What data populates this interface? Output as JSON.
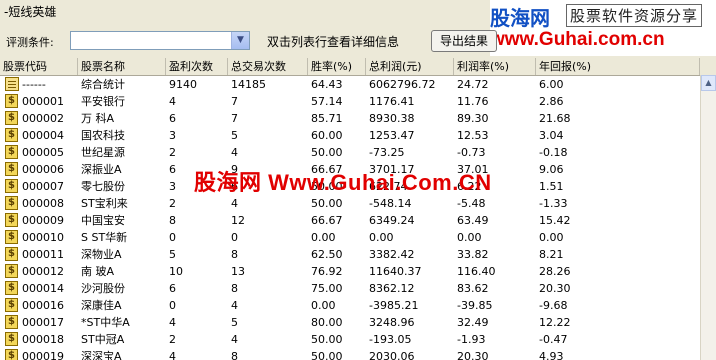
{
  "window": {
    "title": "-短线英雄"
  },
  "logo": {
    "name": "股海网",
    "tagline": "股票软件资源分享",
    "url": "www.Guhai.com.cn"
  },
  "toolbar": {
    "filter_label": "评测条件:",
    "filter_value": "",
    "hint": "双击列表行查看详细信息",
    "export_label": "导出结果"
  },
  "watermark": "股海网 Www.Guhai.Com.CN",
  "table": {
    "columns": [
      "股票代码",
      "股票名称",
      "盈利次数",
      "总交易次数",
      "胜率(%)",
      "总利润(元)",
      "利润率(%)",
      "年回报(%)"
    ],
    "rows": [
      {
        "code": "------",
        "name": "综合统计",
        "wins": "9140",
        "trades": "14185",
        "winrate": "64.43",
        "profit": "6062796.72",
        "rate": "24.72",
        "annual": "6.00",
        "icon": "summary-icon"
      },
      {
        "code": "000001",
        "name": "平安银行",
        "wins": "4",
        "trades": "7",
        "winrate": "57.14",
        "profit": "1176.41",
        "rate": "11.76",
        "annual": "2.86",
        "icon": "dollar-icon"
      },
      {
        "code": "000002",
        "name": "万  科A",
        "wins": "6",
        "trades": "7",
        "winrate": "85.71",
        "profit": "8930.38",
        "rate": "89.30",
        "annual": "21.68",
        "icon": "dollar-icon"
      },
      {
        "code": "000004",
        "name": "国农科技",
        "wins": "3",
        "trades": "5",
        "winrate": "60.00",
        "profit": "1253.47",
        "rate": "12.53",
        "annual": "3.04",
        "icon": "dollar-icon"
      },
      {
        "code": "000005",
        "name": "世纪星源",
        "wins": "2",
        "trades": "4",
        "winrate": "50.00",
        "profit": "-73.25",
        "rate": "-0.73",
        "annual": "-0.18",
        "icon": "dollar-icon"
      },
      {
        "code": "000006",
        "name": "深振业A",
        "wins": "6",
        "trades": "9",
        "winrate": "66.67",
        "profit": "3701.17",
        "rate": "37.01",
        "annual": "9.06",
        "icon": "dollar-icon"
      },
      {
        "code": "000007",
        "name": "零七股份",
        "wins": "3",
        "trades": "6",
        "winrate": "50.00",
        "profit": "622.74",
        "rate": "6.22",
        "annual": "1.51",
        "icon": "dollar-icon"
      },
      {
        "code": "000008",
        "name": "ST宝利来",
        "wins": "2",
        "trades": "4",
        "winrate": "50.00",
        "profit": "-548.14",
        "rate": "-5.48",
        "annual": "-1.33",
        "icon": "dollar-icon"
      },
      {
        "code": "000009",
        "name": "中国宝安",
        "wins": "8",
        "trades": "12",
        "winrate": "66.67",
        "profit": "6349.24",
        "rate": "63.49",
        "annual": "15.42",
        "icon": "dollar-icon"
      },
      {
        "code": "000010",
        "name": "S ST华新",
        "wins": "0",
        "trades": "0",
        "winrate": "0.00",
        "profit": "0.00",
        "rate": "0.00",
        "annual": "0.00",
        "icon": "dollar-icon"
      },
      {
        "code": "000011",
        "name": "深物业A",
        "wins": "5",
        "trades": "8",
        "winrate": "62.50",
        "profit": "3382.42",
        "rate": "33.82",
        "annual": "8.21",
        "icon": "dollar-icon"
      },
      {
        "code": "000012",
        "name": "南  玻A",
        "wins": "10",
        "trades": "13",
        "winrate": "76.92",
        "profit": "11640.37",
        "rate": "116.40",
        "annual": "28.26",
        "icon": "dollar-icon"
      },
      {
        "code": "000014",
        "name": "沙河股份",
        "wins": "6",
        "trades": "8",
        "winrate": "75.00",
        "profit": "8362.12",
        "rate": "83.62",
        "annual": "20.30",
        "icon": "dollar-icon"
      },
      {
        "code": "000016",
        "name": "深康佳A",
        "wins": "0",
        "trades": "4",
        "winrate": "0.00",
        "profit": "-3985.21",
        "rate": "-39.85",
        "annual": "-9.68",
        "icon": "dollar-icon"
      },
      {
        "code": "000017",
        "name": "*ST中华A",
        "wins": "4",
        "trades": "5",
        "winrate": "80.00",
        "profit": "3248.96",
        "rate": "32.49",
        "annual": "12.22",
        "icon": "dollar-icon"
      },
      {
        "code": "000018",
        "name": "ST中冠A",
        "wins": "2",
        "trades": "4",
        "winrate": "50.00",
        "profit": "-193.05",
        "rate": "-1.93",
        "annual": "-0.47",
        "icon": "dollar-icon"
      },
      {
        "code": "000019",
        "name": "深深宝A",
        "wins": "4",
        "trades": "8",
        "winrate": "50.00",
        "profit": "2030.06",
        "rate": "20.30",
        "annual": "4.93",
        "icon": "dollar-icon"
      }
    ]
  }
}
